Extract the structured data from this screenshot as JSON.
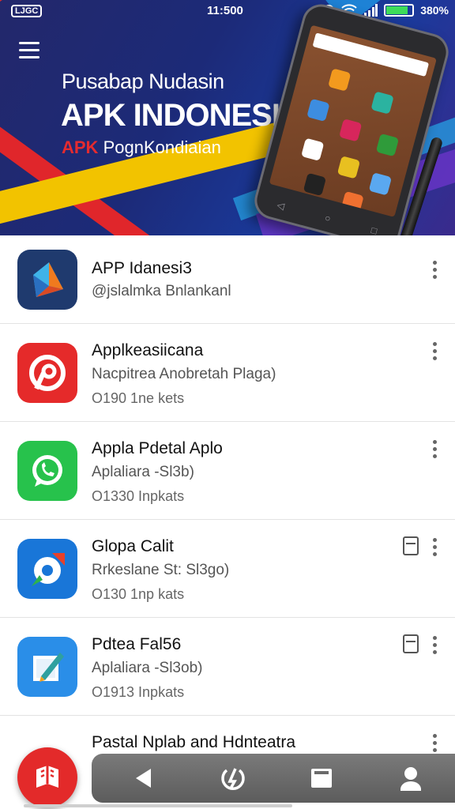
{
  "status_bar": {
    "left_badge": "LJGC",
    "time": "11:500",
    "battery_pct": "380%",
    "battery_level": 0.85
  },
  "banner": {
    "subtitle": "Pusabap Nudasin",
    "title": "APK INDONESIA",
    "tag_prefix": "APK",
    "tag_text": "PognKondiaian"
  },
  "apps": [
    {
      "name": "APP Idanesi3",
      "subtitle": "@jslalmka Bnlankanl",
      "meta": "",
      "icon": "diamond-app-icon",
      "color": "#1f3a6e",
      "has_sd": false
    },
    {
      "name": "Applkeasiicana",
      "subtitle": "Nacpitrea Anobretah Plaga)",
      "meta": "O190 1ne kets",
      "icon": "red-p-app-icon",
      "color": "#e52a2a",
      "has_sd": false
    },
    {
      "name": "Appla Pdetal Aplo",
      "subtitle": "Aplaliara -Sl3b)",
      "meta": "O1330 Inpkats",
      "icon": "whatsapp-icon",
      "color": "#27c24c",
      "has_sd": false
    },
    {
      "name": "Glopa Calit",
      "subtitle": "Rrkeslane St: Sl3go)",
      "meta": "O130 1np kats",
      "icon": "blue-target-app-icon",
      "color": "#1976d8",
      "has_sd": true
    },
    {
      "name": "Pdtea Fal56",
      "subtitle": "Aplaliara -Sl3ob)",
      "meta": "O1913 Inpkats",
      "icon": "blue-edit-app-icon",
      "color": "#2a8ee8",
      "has_sd": true
    },
    {
      "name": "Pastal Nplab and Hdnteatra",
      "subtitle": "",
      "meta": "",
      "icon": "red-book-app-icon",
      "color": "#e32a2a",
      "has_sd": false
    }
  ],
  "navbar": {
    "items": [
      "back-icon",
      "sync-icon",
      "inbox-icon",
      "profile-icon"
    ]
  }
}
